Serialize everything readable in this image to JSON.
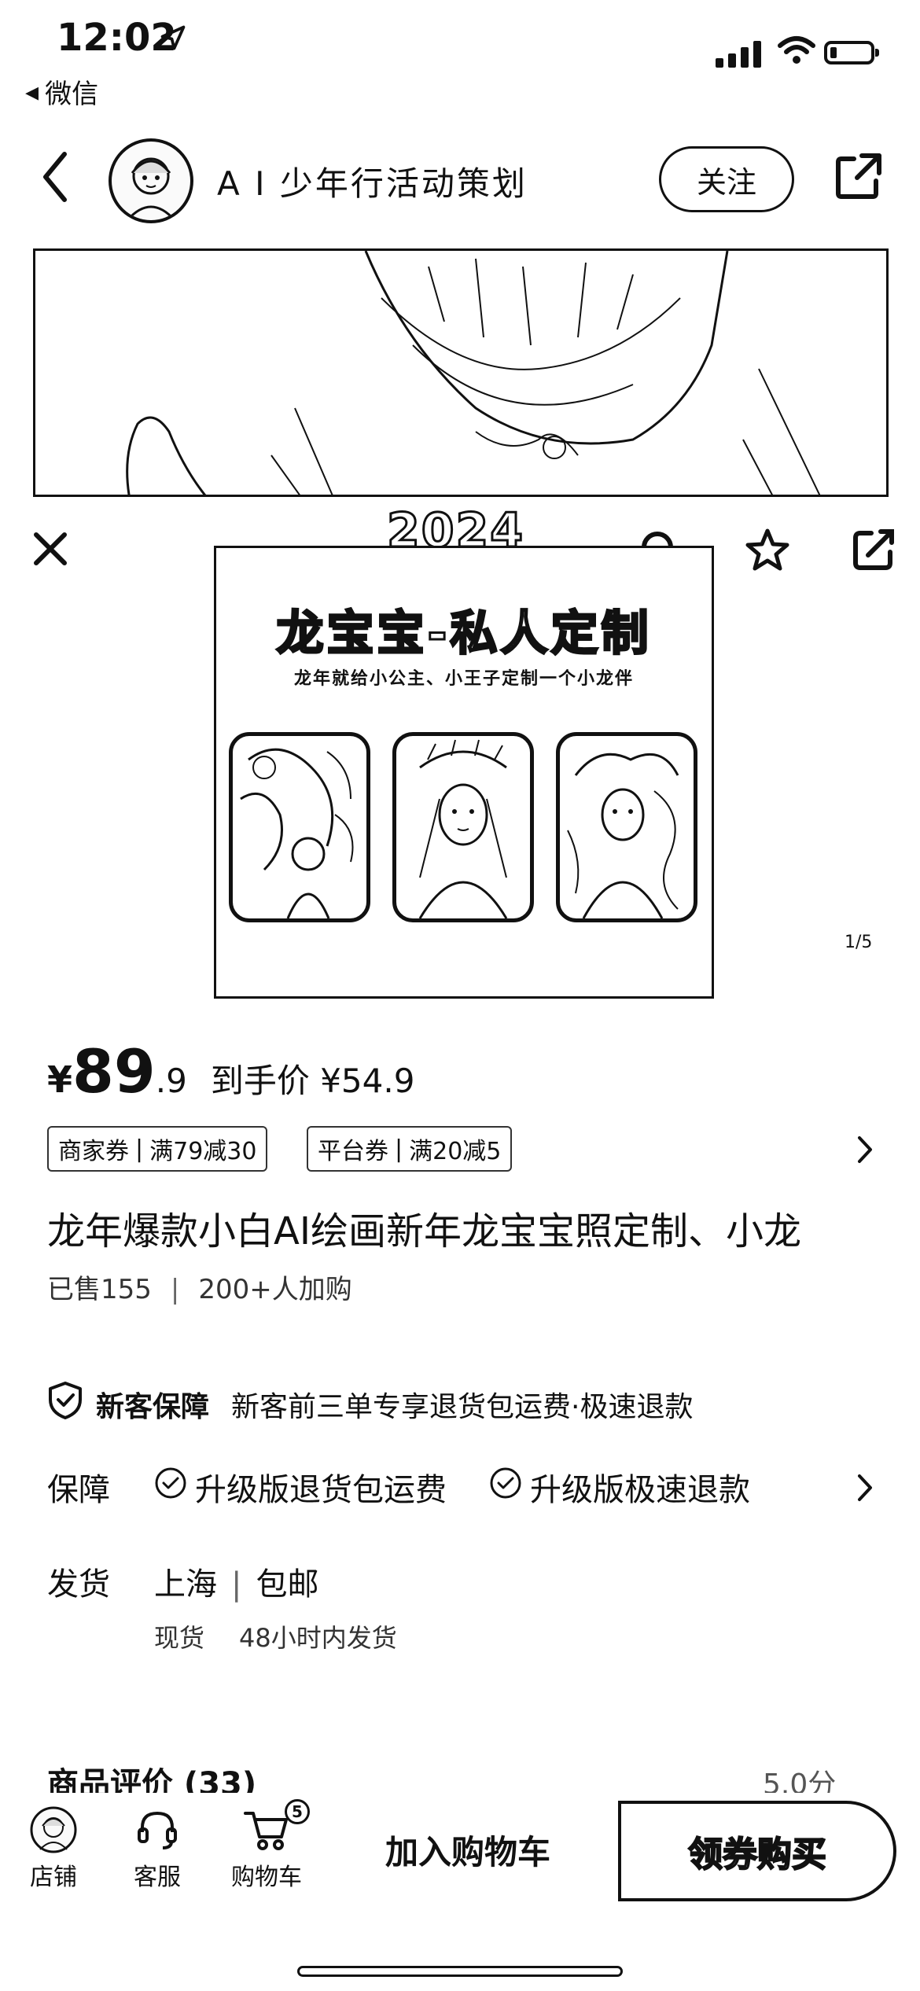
{
  "status_bar": {
    "time": "12:02",
    "back_app": "微信"
  },
  "header": {
    "store_name": "A I 少年行活动策划",
    "follow_label": "关注"
  },
  "overlay": {
    "badge_year": "2024"
  },
  "product_image": {
    "title": "龙宝宝-私人定制",
    "subtitle": "龙年就给小公主、小王子定制一个小龙伴",
    "page_indicator": "1/5"
  },
  "price": {
    "symbol": "¥",
    "integer": "89",
    "decimal": ".9",
    "final_label": "到手价 ¥54.9"
  },
  "coupons": [
    {
      "type": "商家券",
      "desc": "满79减30"
    },
    {
      "type": "平台券",
      "desc": "满20减5"
    }
  ],
  "product_title": "龙年爆款小白AI绘画新年龙宝宝照定制、小龙",
  "sales": {
    "sold": "已售155",
    "cart_adds": "200+人加购"
  },
  "new_customer": {
    "label": "新客保障",
    "desc": "新客前三单专享退货包运费·极速退款"
  },
  "assurance": {
    "label": "保障",
    "items": [
      "升级版退货包运费",
      "升级版极速退款"
    ]
  },
  "shipping": {
    "label": "发货",
    "from": "上海",
    "fee": "包邮",
    "stock": "现货",
    "time": "48小时内发货"
  },
  "reviews": {
    "label": "商品评价 (33)",
    "score": "5.0分"
  },
  "bottom_bar": {
    "tabs": [
      {
        "label": "店铺",
        "icon": "store-avatar-icon"
      },
      {
        "label": "客服",
        "icon": "headset-icon"
      },
      {
        "label": "购物车",
        "icon": "cart-icon"
      }
    ],
    "cart_count": "5",
    "add_to_cart": "加入购物车",
    "buy": "领券购买"
  }
}
